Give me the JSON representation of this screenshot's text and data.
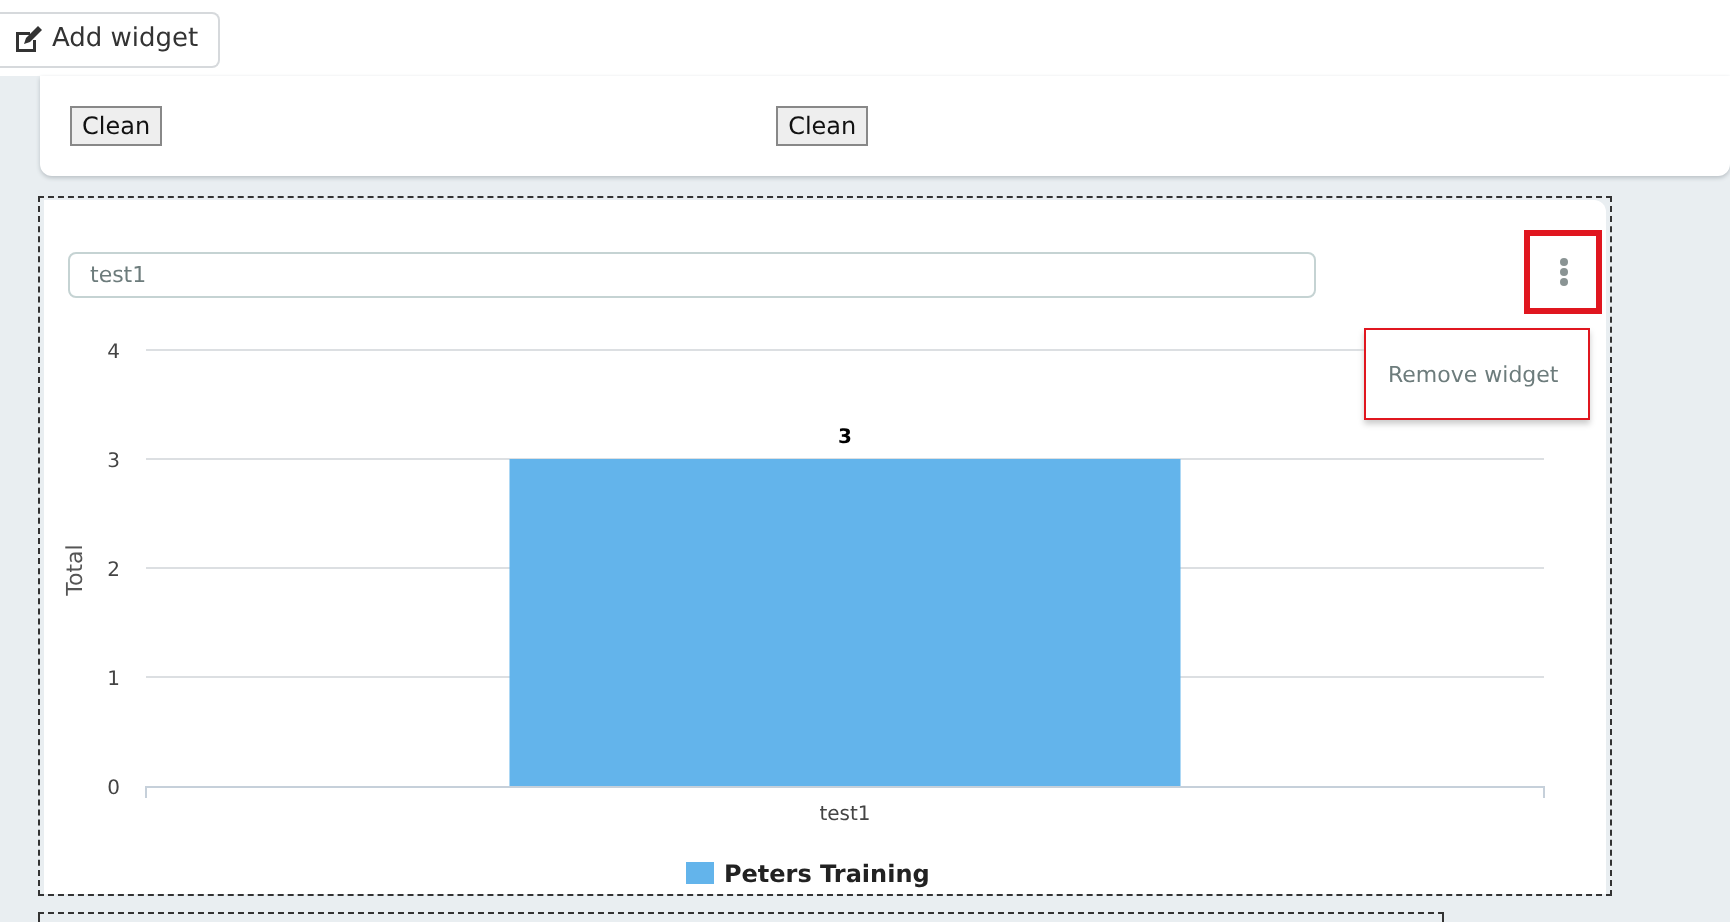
{
  "toolbar": {
    "add_button": "Add widget"
  },
  "filters": {
    "buttons": [
      "Clean",
      "Clean"
    ]
  },
  "widget": {
    "title_value": "test1",
    "menu_open": true,
    "menu_items": [
      "Remove widget"
    ],
    "chart_data": {
      "type": "bar",
      "ylabel": "Total",
      "categories": [
        "test1"
      ],
      "series": [
        {
          "name": "Peters Training",
          "color": "#63b4eb",
          "values": [
            3
          ]
        }
      ],
      "ylim": [
        0,
        4
      ],
      "yticks": [
        0,
        1,
        2,
        3,
        4
      ],
      "grid": true,
      "data_labels": true
    }
  }
}
